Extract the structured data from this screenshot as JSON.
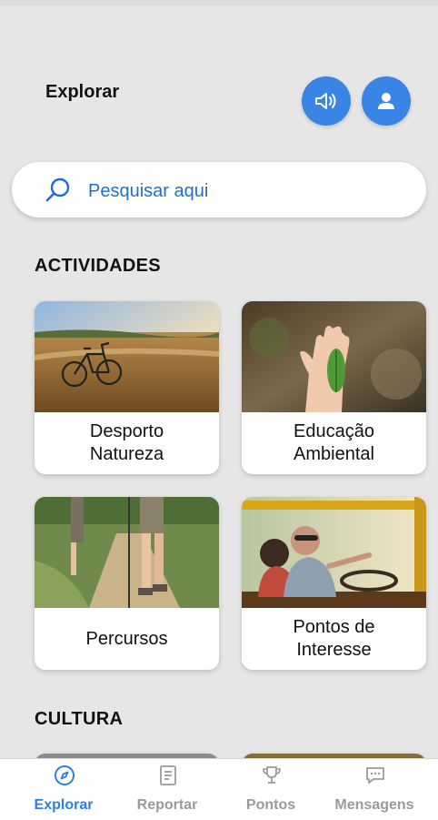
{
  "header": {
    "title": "Explorar"
  },
  "actions": {
    "sound_icon": "speaker-icon",
    "profile_icon": "user-icon"
  },
  "search": {
    "placeholder": "Pesquisar aqui"
  },
  "sections": {
    "activities": {
      "title": "ACTIVIDADES",
      "cards": [
        {
          "label": "Desporto\nNatureza"
        },
        {
          "label": "Educação\nAmbiental"
        },
        {
          "label": "Percursos"
        },
        {
          "label": "Pontos de\nInteresse"
        }
      ]
    },
    "culture": {
      "title": "CULTURA"
    }
  },
  "bottom_nav": {
    "items": [
      {
        "label": "Explorar",
        "icon": "compass-icon",
        "active": true
      },
      {
        "label": "Reportar",
        "icon": "report-icon",
        "active": false
      },
      {
        "label": "Pontos",
        "icon": "trophy-icon",
        "active": false
      },
      {
        "label": "Mensagens",
        "icon": "message-icon",
        "active": false
      }
    ]
  },
  "colors": {
    "accent": "#3a84e6",
    "active_nav": "#2f7de0",
    "inactive_nav": "#9a9a9a",
    "background": "#e6e6e6"
  }
}
